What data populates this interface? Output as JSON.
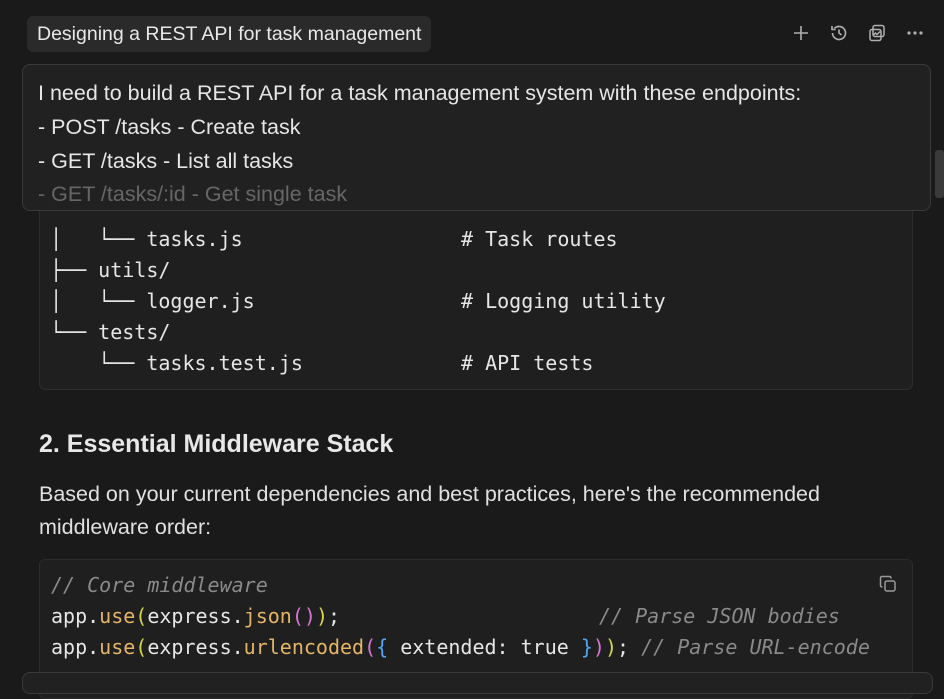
{
  "header": {
    "title": "Designing a REST API for task management",
    "actions": [
      {
        "icon": "plus-icon"
      },
      {
        "icon": "history-icon"
      },
      {
        "icon": "copy-chat-icon"
      },
      {
        "icon": "more-icon"
      }
    ]
  },
  "prompt": {
    "lines": [
      "I need to build a REST API for a task management system with these endpoints:",
      "- POST /tasks - Create task",
      "- GET /tasks - List all tasks",
      "- GET /tasks/:id - Get single task"
    ]
  },
  "tree": {
    "lines": [
      {
        "text": "│   └── tasks.js",
        "comment": "# Task routes"
      },
      {
        "text": "├── utils/",
        "comment": ""
      },
      {
        "text": "│   └── logger.js",
        "comment": "# Logging utility"
      },
      {
        "text": "└── tests/",
        "comment": ""
      },
      {
        "text": "    └── tasks.test.js",
        "comment": "# API tests"
      }
    ]
  },
  "section": {
    "heading": "2. Essential Middleware Stack",
    "paragraph": "Based on your current dependencies and best practices, here's the recommended middleware order:"
  },
  "code": {
    "comment_core": "// Core middleware",
    "line1_pre": "app.",
    "line1_use": "use",
    "line1_open": "(",
    "line1_obj": "express.",
    "line1_fn": "json",
    "line1_inner": "()",
    "line1_close": ");",
    "line1_comment": "// Parse JSON bodies",
    "line2_pre": "app.",
    "line2_use": "use",
    "line2_open": "(",
    "line2_obj": "express.",
    "line2_fn": "urlencoded",
    "line2_paren": "(",
    "line2_brace_open": "{",
    "line2_args": " extended: true ",
    "line2_brace_close": "}",
    "line2_paren_close": ")",
    "line2_close": ");",
    "line2_comment": "// Parse URL-encode",
    "copy_icon": "copy-icon"
  }
}
